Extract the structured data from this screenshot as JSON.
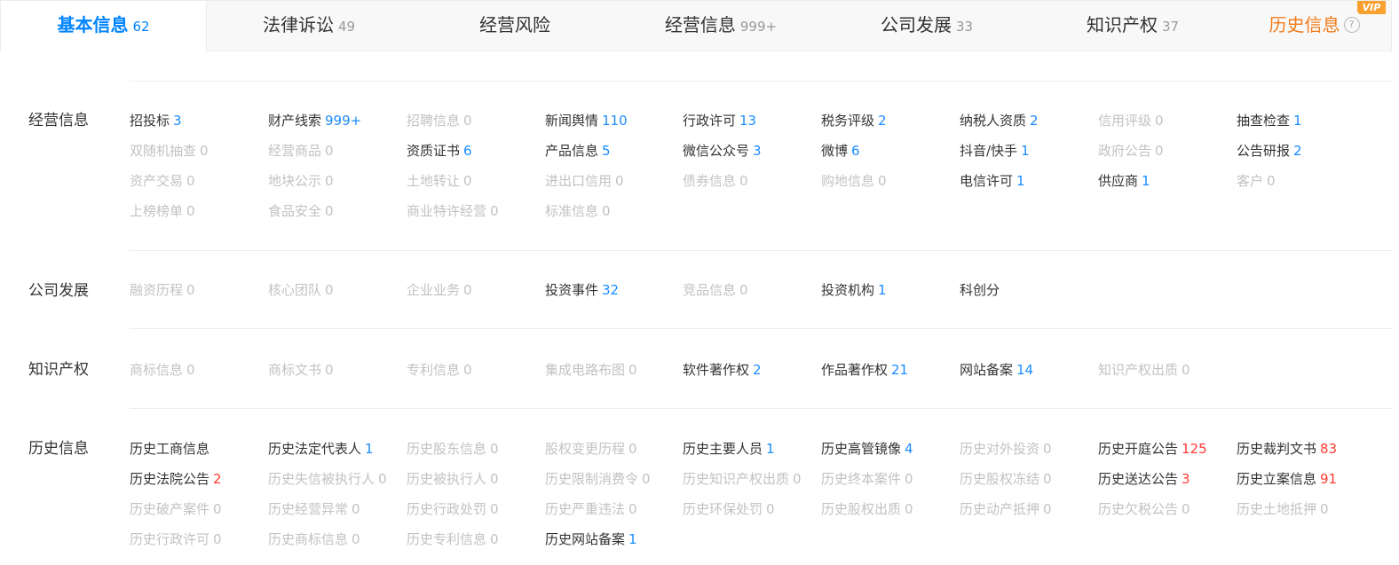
{
  "tabs": [
    {
      "label": "基本信息",
      "count": "62"
    },
    {
      "label": "法律诉讼",
      "count": "49"
    },
    {
      "label": "经营风险",
      "count": ""
    },
    {
      "label": "经营信息",
      "count": "999+"
    },
    {
      "label": "公司发展",
      "count": "33"
    },
    {
      "label": "知识产权",
      "count": "37"
    },
    {
      "label": "历史信息",
      "count": "",
      "badge": "VIP"
    }
  ],
  "help_glyph": "?",
  "sections": [
    {
      "title": "经营信息",
      "items": [
        {
          "label": "招投标",
          "count": "3",
          "active": true
        },
        {
          "label": "财产线索",
          "count": "999+",
          "active": true
        },
        {
          "label": "招聘信息",
          "count": "0",
          "active": false
        },
        {
          "label": "新闻舆情",
          "count": "110",
          "active": true
        },
        {
          "label": "行政许可",
          "count": "13",
          "active": true
        },
        {
          "label": "税务评级",
          "count": "2",
          "active": true
        },
        {
          "label": "纳税人资质",
          "count": "2",
          "active": true
        },
        {
          "label": "信用评级",
          "count": "0",
          "active": false
        },
        {
          "label": "抽查检查",
          "count": "1",
          "active": true
        },
        {
          "label": "双随机抽查",
          "count": "0",
          "active": false
        },
        {
          "label": "经营商品",
          "count": "0",
          "active": false
        },
        {
          "label": "资质证书",
          "count": "6",
          "active": true
        },
        {
          "label": "产品信息",
          "count": "5",
          "active": true
        },
        {
          "label": "微信公众号",
          "count": "3",
          "active": true
        },
        {
          "label": "微博",
          "count": "6",
          "active": true
        },
        {
          "label": "抖音/快手",
          "count": "1",
          "active": true
        },
        {
          "label": "政府公告",
          "count": "0",
          "active": false
        },
        {
          "label": "公告研报",
          "count": "2",
          "active": true
        },
        {
          "label": "资产交易",
          "count": "0",
          "active": false
        },
        {
          "label": "地块公示",
          "count": "0",
          "active": false
        },
        {
          "label": "土地转让",
          "count": "0",
          "active": false
        },
        {
          "label": "进出口信用",
          "count": "0",
          "active": false
        },
        {
          "label": "债券信息",
          "count": "0",
          "active": false
        },
        {
          "label": "购地信息",
          "count": "0",
          "active": false
        },
        {
          "label": "电信许可",
          "count": "1",
          "active": true
        },
        {
          "label": "供应商",
          "count": "1",
          "active": true
        },
        {
          "label": "客户",
          "count": "0",
          "active": false
        },
        {
          "label": "上榜榜单",
          "count": "0",
          "active": false
        },
        {
          "label": "食品安全",
          "count": "0",
          "active": false
        },
        {
          "label": "商业特许经营",
          "count": "0",
          "active": false
        },
        {
          "label": "标准信息",
          "count": "0",
          "active": false
        }
      ]
    },
    {
      "title": "公司发展",
      "items": [
        {
          "label": "融资历程",
          "count": "0",
          "active": false
        },
        {
          "label": "核心团队",
          "count": "0",
          "active": false
        },
        {
          "label": "企业业务",
          "count": "0",
          "active": false
        },
        {
          "label": "投资事件",
          "count": "32",
          "active": true
        },
        {
          "label": "竞品信息",
          "count": "0",
          "active": false
        },
        {
          "label": "投资机构",
          "count": "1",
          "active": true
        },
        {
          "label": "科创分",
          "count": "",
          "active": true
        }
      ]
    },
    {
      "title": "知识产权",
      "items": [
        {
          "label": "商标信息",
          "count": "0",
          "active": false
        },
        {
          "label": "商标文书",
          "count": "0",
          "active": false
        },
        {
          "label": "专利信息",
          "count": "0",
          "active": false
        },
        {
          "label": "集成电路布图",
          "count": "0",
          "active": false
        },
        {
          "label": "软件著作权",
          "count": "2",
          "active": true
        },
        {
          "label": "作品著作权",
          "count": "21",
          "active": true
        },
        {
          "label": "网站备案",
          "count": "14",
          "active": true
        },
        {
          "label": "知识产权出质",
          "count": "0",
          "active": false
        }
      ]
    },
    {
      "title": "历史信息",
      "items": [
        {
          "label": "历史工商信息",
          "count": "",
          "active": true
        },
        {
          "label": "历史法定代表人",
          "count": "1",
          "active": true
        },
        {
          "label": "历史股东信息",
          "count": "0",
          "active": false
        },
        {
          "label": "股权变更历程",
          "count": "0",
          "active": false
        },
        {
          "label": "历史主要人员",
          "count": "1",
          "active": true
        },
        {
          "label": "历史高管镜像",
          "count": "4",
          "active": true
        },
        {
          "label": "历史对外投资",
          "count": "0",
          "active": false
        },
        {
          "label": "历史开庭公告",
          "count": "125",
          "active": true,
          "alert": true
        },
        {
          "label": "历史裁判文书",
          "count": "83",
          "active": true,
          "alert": true
        },
        {
          "label": "历史法院公告",
          "count": "2",
          "active": true,
          "alert": true
        },
        {
          "label": "历史失信被执行人",
          "count": "0",
          "active": false
        },
        {
          "label": "历史被执行人",
          "count": "0",
          "active": false
        },
        {
          "label": "历史限制消费令",
          "count": "0",
          "active": false
        },
        {
          "label": "历史知识产权出质",
          "count": "0",
          "active": false
        },
        {
          "label": "历史终本案件",
          "count": "0",
          "active": false
        },
        {
          "label": "历史股权冻结",
          "count": "0",
          "active": false
        },
        {
          "label": "历史送达公告",
          "count": "3",
          "active": true,
          "alert": true
        },
        {
          "label": "历史立案信息",
          "count": "91",
          "active": true,
          "alert": true
        },
        {
          "label": "历史破产案件",
          "count": "0",
          "active": false
        },
        {
          "label": "历史经营异常",
          "count": "0",
          "active": false
        },
        {
          "label": "历史行政处罚",
          "count": "0",
          "active": false
        },
        {
          "label": "历史严重违法",
          "count": "0",
          "active": false
        },
        {
          "label": "历史环保处罚",
          "count": "0",
          "active": false
        },
        {
          "label": "历史股权出质",
          "count": "0",
          "active": false
        },
        {
          "label": "历史动产抵押",
          "count": "0",
          "active": false
        },
        {
          "label": "历史欠税公告",
          "count": "0",
          "active": false
        },
        {
          "label": "历史土地抵押",
          "count": "0",
          "active": false
        },
        {
          "label": "历史行政许可",
          "count": "0",
          "active": false
        },
        {
          "label": "历史商标信息",
          "count": "0",
          "active": false
        },
        {
          "label": "历史专利信息",
          "count": "0",
          "active": false
        },
        {
          "label": "历史网站备案",
          "count": "1",
          "active": true
        }
      ]
    }
  ],
  "colors": {
    "accent": "#0084ff",
    "vip": "#f07c1b",
    "count": "#1a8cff",
    "alert": "#ff3b30",
    "disabled": "#c2c2c2"
  }
}
